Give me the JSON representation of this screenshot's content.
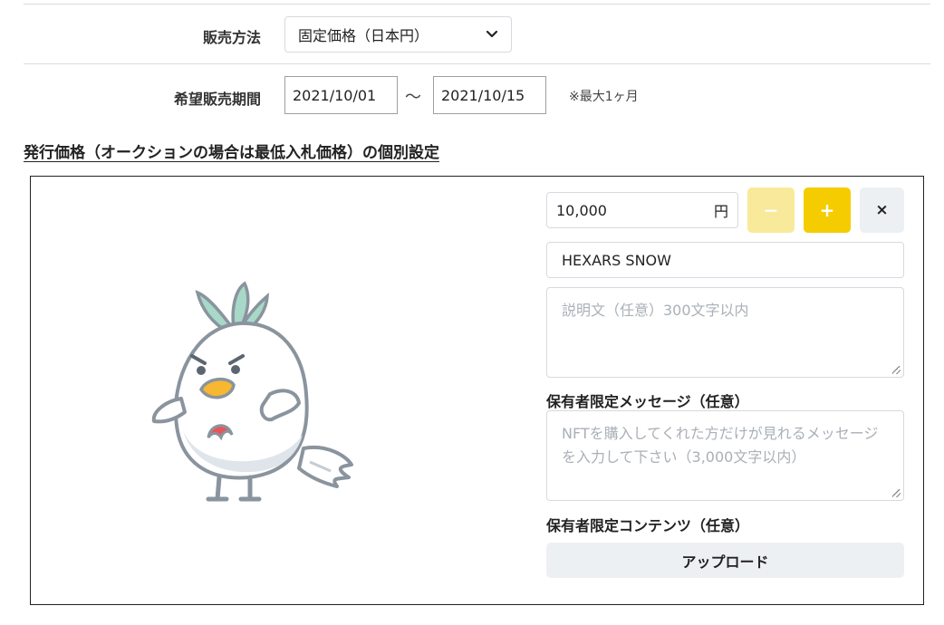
{
  "sales_method": {
    "label": "販売方法",
    "selected": "固定価格（日本円）",
    "icon": "chevron-down-icon"
  },
  "sales_period": {
    "label": "希望販売期間",
    "start": "2021/10/01",
    "separator": "〜",
    "end": "2021/10/15",
    "note": "※最大1ヶ月"
  },
  "section": {
    "title": "発行価格（オークションの場合は最低入札価格）の個別設定"
  },
  "item": {
    "price_value": "10,000",
    "price_unit": "円",
    "minus_label": "−",
    "plus_label": "+",
    "remove_label": "×",
    "name_value": "HEXARS SNOW",
    "description_placeholder": "説明文（任意）300文字以内",
    "message_label": "保有者限定メッセージ（任意）",
    "message_placeholder": "NFTを購入してくれた方だけが見れるメッセージを入力して下さい（3,000文字以内）",
    "content_label": "保有者限定コンテンツ（任意）",
    "upload_label": "アップロード",
    "colors": {
      "minus_bg": "#f9e99a",
      "plus_bg": "#f5cc00",
      "remove_bg": "#edf0f3"
    }
  }
}
